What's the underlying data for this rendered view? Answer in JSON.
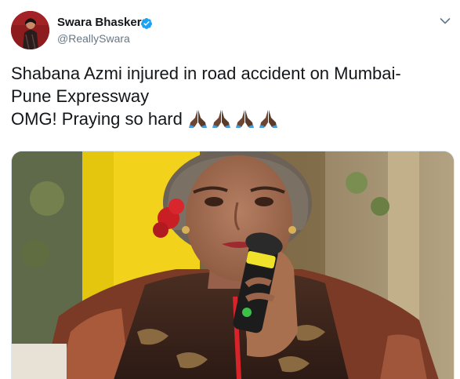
{
  "author": {
    "name": "Swara Bhasker",
    "handle": "@ReallySwara",
    "verified": true
  },
  "tweet": {
    "line1": "Shabana Azmi injured in road accident on Mumbai-",
    "line2": "Pune Expressway",
    "line3": "OMG! Praying so hard",
    "emoji_count": 4,
    "emoji": "folded-hands-medium-dark-skin"
  },
  "colors": {
    "text": "#14171a",
    "secondary": "#657786",
    "verified": "#1da1f2"
  },
  "icons": {
    "verified": "verified-badge-icon",
    "menu": "chevron-down-icon"
  }
}
